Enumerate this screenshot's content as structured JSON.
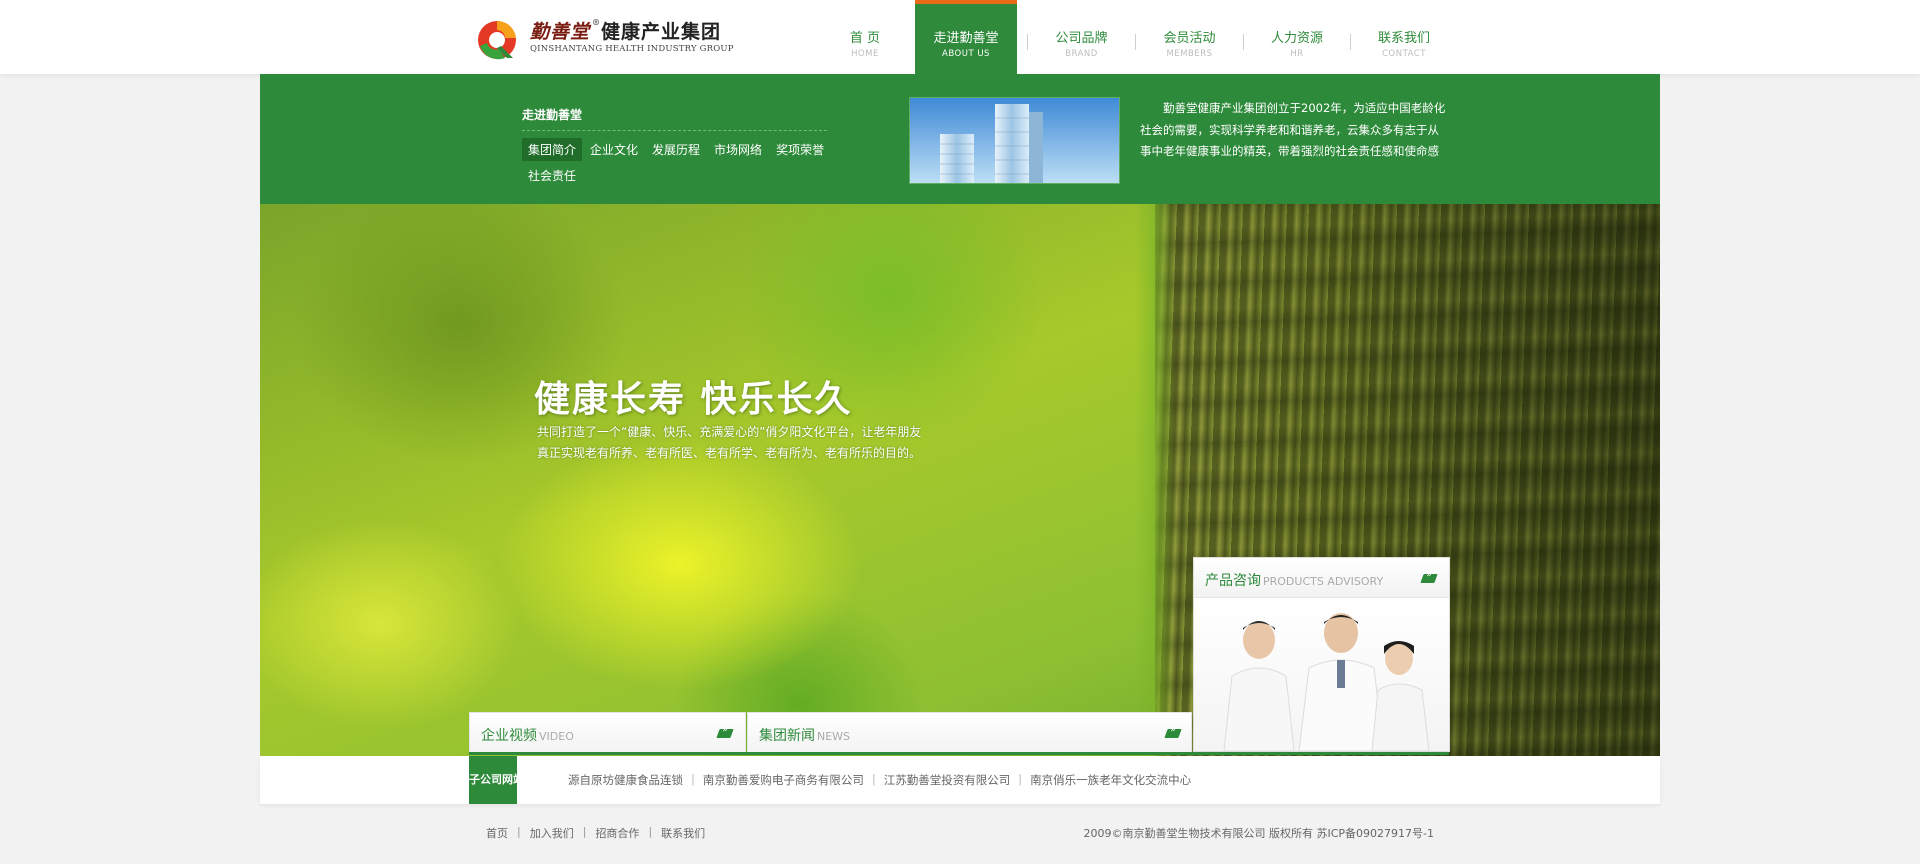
{
  "logo": {
    "brand_text": "勤善堂",
    "registered_mark": "®",
    "cn_name": "健康产业集团",
    "en_name": "QINSHANTANG HEALTH INDUSTRY GROUP"
  },
  "nav": {
    "items": [
      {
        "cn": "首  页",
        "en": "HOME"
      },
      {
        "cn": "走进勤善堂",
        "en": "ABOUT US",
        "active": true
      },
      {
        "cn": "公司品牌",
        "en": "BRAND"
      },
      {
        "cn": "会员活动",
        "en": "MEMBERS"
      },
      {
        "cn": "人力资源",
        "en": "HR"
      },
      {
        "cn": "联系我们",
        "en": "CONTACT"
      }
    ]
  },
  "about": {
    "title": "走进勤善堂",
    "submenu": [
      "集团简介",
      "企业文化",
      "发展历程",
      "市场网络",
      "奖项荣誉",
      "社会责任"
    ],
    "active_submenu": "集团简介",
    "intro": "勤善堂健康产业集团创立于2002年，为适应中国老龄化社会的需要，实现科学养老和和谐养老，云集众多有志于从事中老年健康事业的精英，带着强烈的社会责任感和使命感"
  },
  "hero": {
    "slogan": "健康长寿  快乐长久",
    "description": "共同打造了一个“健康、快乐、充满爱心的”俏夕阳文化平台，让老年朋友真正实现老有所养、老有所医、老有所学、老有所为、老有所乐的目的。"
  },
  "panels": {
    "video": {
      "cn": "企业视频",
      "en": "VIDEO"
    },
    "news": {
      "cn": "集团新闻",
      "en": "NEWS"
    },
    "products": {
      "cn": "产品咨询",
      "en": "PRODUCTS ADVISORY"
    }
  },
  "subsidiaries": {
    "label": "子公司网站",
    "links": [
      "源自原坊健康食品连锁",
      "南京勤善爱购电子商务有限公司",
      "江苏勤善堂投资有限公司",
      "南京俏乐一族老年文化交流中心"
    ]
  },
  "footer": {
    "links": [
      "首页",
      "加入我们",
      "招商合作",
      "联系我们"
    ],
    "copyright": "2009©南京勤善堂生物技术有限公司 版权所有 苏ICP备09027917号-1"
  },
  "colors": {
    "primary_green": "#2e8a3b",
    "accent_orange": "#e96b17"
  },
  "icons": {
    "more": "more-arrow-icon",
    "logo": "logo-mark-icon"
  }
}
